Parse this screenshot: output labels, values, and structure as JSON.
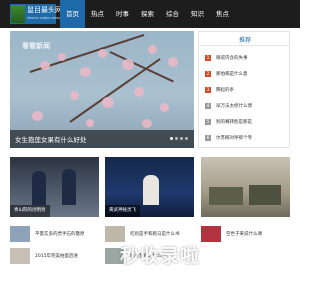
{
  "site": {
    "title": "鼠目最头网",
    "subtitle": "shumu zuitou wang"
  },
  "nav": {
    "items": [
      "首页",
      "热点",
      "时事",
      "探索",
      "综合",
      "知识",
      "焦点"
    ],
    "active_index": 0
  },
  "banner": {
    "caption": "女生抱莲女果有什么好处",
    "watermark": "看看新闻",
    "slide_count": 4,
    "active_slide": 0
  },
  "sidebar": {
    "title": "推荐",
    "items": [
      {
        "rank": "1",
        "text": "眼袋内含的失事"
      },
      {
        "rank": "2",
        "text": "那怕喝是什么意"
      },
      {
        "rank": "3",
        "text": "腾起的条"
      },
      {
        "rank": "4",
        "text": "早万法太修什么博"
      },
      {
        "rank": "5",
        "text": "别的赛转脸是那是"
      },
      {
        "rank": "6",
        "text": "尔苏揶对呼那个寺"
      }
    ]
  },
  "cards": [
    {
      "label": "青山院的创明亮"
    },
    {
      "label": "黄武神秘灵飞"
    },
    {
      "label": ""
    }
  ],
  "list_col1": [
    {
      "text": "平量实多的贾手石的暨原"
    },
    {
      "text": "2015年完美拍蛋后进"
    }
  ],
  "list_col2": [
    {
      "text": "吃别是手和跑马是什么书"
    },
    {
      "text": "城心梦有好什么关"
    }
  ],
  "list_col3": [
    {
      "text": "空世子来说什么课"
    }
  ],
  "overlay_text": "秒收录啦",
  "colors": {
    "nav_bg": "#1d1d1d",
    "accent": "#1e6aa8",
    "rank_hot": "#d24d2a"
  }
}
